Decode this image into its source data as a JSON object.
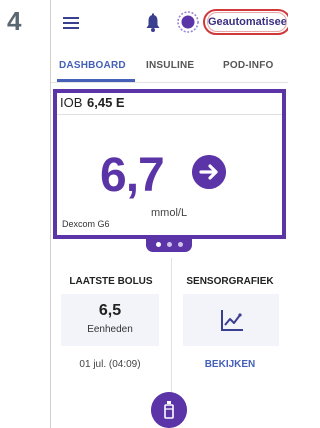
{
  "step_number": "4",
  "header": {
    "auto_mode_label": "Geautomatiseerd"
  },
  "tabs": [
    {
      "label": "DASHBOARD"
    },
    {
      "label": "INSULINE"
    },
    {
      "label": "POD-INFO"
    }
  ],
  "iob": {
    "label": "IOB",
    "value": "6,45 E"
  },
  "glucose": {
    "value": "6,7",
    "unit": "mmol/L",
    "sensor": "Dexcom G6",
    "trend": "steady"
  },
  "last_bolus": {
    "title": "LAATSTE BOLUS",
    "value": "6,5",
    "unit": "Eenheden",
    "date": "01 jul. (04:09)"
  },
  "sensor_graph": {
    "title": "SENSORGRAFIEK",
    "link": "BEKIJKEN"
  },
  "colors": {
    "accent": "#5b34a8",
    "tab_active": "#4660b7",
    "alert_border": "#d0393c"
  }
}
